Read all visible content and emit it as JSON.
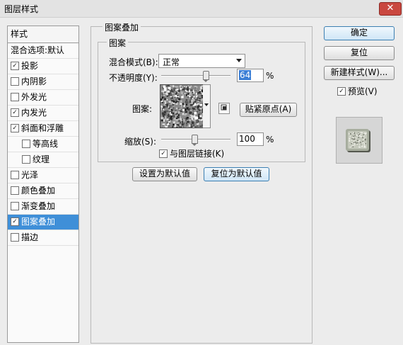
{
  "window": {
    "title": "图层样式",
    "close_label": "✕"
  },
  "sidebar": {
    "header": "样式",
    "blend_options": "混合选项:默认",
    "items": [
      {
        "label": "投影",
        "checked": true,
        "sub": false,
        "active": false
      },
      {
        "label": "内阴影",
        "checked": false,
        "sub": false,
        "active": false
      },
      {
        "label": "外发光",
        "checked": false,
        "sub": false,
        "active": false
      },
      {
        "label": "内发光",
        "checked": true,
        "sub": false,
        "active": false
      },
      {
        "label": "斜面和浮雕",
        "checked": true,
        "sub": false,
        "active": false
      },
      {
        "label": "等高线",
        "checked": false,
        "sub": true,
        "active": false
      },
      {
        "label": "纹理",
        "checked": false,
        "sub": true,
        "active": false
      },
      {
        "label": "光泽",
        "checked": false,
        "sub": false,
        "active": false
      },
      {
        "label": "颜色叠加",
        "checked": false,
        "sub": false,
        "active": false
      },
      {
        "label": "渐变叠加",
        "checked": false,
        "sub": false,
        "active": false
      },
      {
        "label": "图案叠加",
        "checked": true,
        "sub": false,
        "active": true
      },
      {
        "label": "描边",
        "checked": false,
        "sub": false,
        "active": false
      }
    ]
  },
  "panel": {
    "group_title": "图案叠加",
    "subgroup_title": "图案",
    "blend_mode_label": "混合模式(B):",
    "blend_mode_value": "正常",
    "opacity_label": "不透明度(Y):",
    "opacity_value": "64",
    "opacity_unit": "%",
    "opacity_level": 0.64,
    "pattern_label": "图案:",
    "snap_origin_label": "贴紧原点(A)",
    "scale_label": "缩放(S):",
    "scale_value": "100",
    "scale_unit": "%",
    "scale_level": 0.48,
    "link_label": "与图层链接(K)",
    "link_checked": true,
    "set_default_label": "设置为默认值",
    "reset_default_label": "复位为默认值"
  },
  "actions": {
    "ok_label": "确定",
    "reset_label": "复位",
    "new_style_label": "新建样式(W)...",
    "preview_label": "预览(V)",
    "preview_checked": true
  },
  "icons": {
    "checkbox_check": "✓",
    "pattern_picker": "pattern-swatch",
    "pattern_menu": "pattern-menu-icon"
  }
}
